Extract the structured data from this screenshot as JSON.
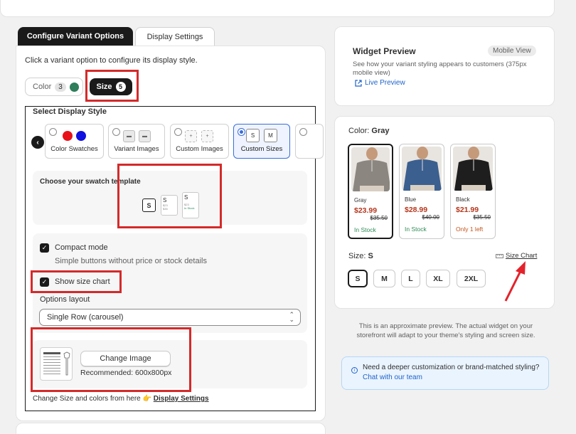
{
  "tabs": [
    {
      "label": "Configure Variant Options",
      "active": true
    },
    {
      "label": "Display Settings",
      "active": false
    }
  ],
  "config": {
    "instruction": "Click a variant option to configure its display style.",
    "variant_options": [
      {
        "label": "Color",
        "count": "3"
      },
      {
        "label": "Size",
        "count": "5"
      }
    ],
    "select_display_style_title": "Select Display Style",
    "display_styles": [
      {
        "label": "Color Swatches",
        "selected": false
      },
      {
        "label": "Variant Images",
        "selected": false
      },
      {
        "label": "Custom Images",
        "selected": false
      },
      {
        "label": "Custom Sizes",
        "selected": true
      }
    ],
    "custom_sizes_preview": [
      "S",
      "M"
    ],
    "template": {
      "title": "Choose your swatch template",
      "options": [
        {
          "size": "S",
          "sub": "$23",
          "extra": ""
        },
        {
          "size": "S",
          "sub": "$23",
          "extra": "$35"
        },
        {
          "size": "S",
          "sub": "$23",
          "extra": "In Stock"
        }
      ]
    },
    "compact_mode": {
      "label": "Compact mode",
      "help": "Simple buttons without price or stock details",
      "checked": true
    },
    "show_size_chart": {
      "label": "Show size chart",
      "checked": true
    },
    "options_layout": {
      "label": "Options layout",
      "value": "Single Row (carousel)"
    },
    "image": {
      "button": "Change Image",
      "recommended": "Recommended: 600x800px"
    },
    "footer": {
      "text": "Change Size and colors from here 👉",
      "link": "Display Settings"
    }
  },
  "widget_preview": {
    "title": "Widget Preview",
    "badge": "Mobile View",
    "description": "See how your variant styling appears to customers (375px mobile view)",
    "live_link": "Live Preview"
  },
  "preview": {
    "color_label": "Color:",
    "color_value": "Gray",
    "products": [
      {
        "name": "Gray",
        "price": "$23.99",
        "old_price": "$35.50",
        "stock": "In Stock",
        "stock_color": "#2e8b57",
        "shirt_color": "#8b8680",
        "selected": true
      },
      {
        "name": "Blue",
        "price": "$28.99",
        "old_price": "$40.00",
        "stock": "In Stock",
        "stock_color": "#2e8b57",
        "shirt_color": "#3b5f8f",
        "selected": false
      },
      {
        "name": "Black",
        "price": "$21.99",
        "old_price": "$35.50",
        "stock": "Only 1 left",
        "stock_color": "#c4541d",
        "shirt_color": "#1e1e1e",
        "selected": false
      }
    ],
    "size_label": "Size:",
    "size_value": "S",
    "size_chart_link": "Size Chart",
    "sizes": [
      {
        "label": "S",
        "active": true
      },
      {
        "label": "M",
        "active": false
      },
      {
        "label": "L",
        "active": false
      },
      {
        "label": "XL",
        "active": false
      },
      {
        "label": "2XL",
        "active": false
      }
    ]
  },
  "approx_note": "This is an approximate preview. The actual widget on your storefront will adapt to your theme's styling and screen size.",
  "help": {
    "text": "Need a deeper customization or brand-matched styling?",
    "link": "Chat with our team"
  },
  "colors": {
    "accent_blue": "#1e63c9",
    "price_red": "#b5351b",
    "annotation_red": "#d42a2a",
    "dark": "#1a1a1a"
  }
}
